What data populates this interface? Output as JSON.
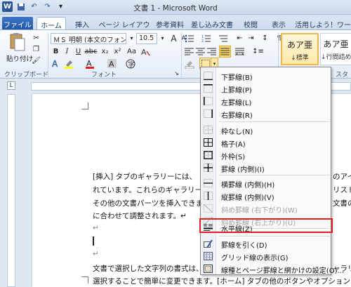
{
  "window": {
    "title": "文書 1 - Microsoft Word"
  },
  "tabs": [
    {
      "label": "ファイル"
    },
    {
      "label": "ホーム"
    },
    {
      "label": "挿入"
    },
    {
      "label": "ページ レイアウト"
    },
    {
      "label": "参考資料"
    },
    {
      "label": "差し込み文書"
    },
    {
      "label": "校閲"
    },
    {
      "label": "表示"
    },
    {
      "label": "活用しよう！ワード"
    }
  ],
  "ribbon": {
    "paste_label": "貼り付け",
    "font_name": "ＭＳ 明朝 (本文のフォン",
    "font_size": "10.5",
    "groups": {
      "clipboard": "クリップボード",
      "font": "フォント",
      "styles": "スター"
    },
    "styles": [
      {
        "sample": "あア亜",
        "name": "↓標準"
      },
      {
        "sample": "あア亜",
        "name": "↓行間詰め"
      }
    ]
  },
  "ruler": {
    "corner": "L"
  },
  "document": {
    "lines": [
      "[挿入] タブのギャラリーには、",
      "れています。これらのギャラリー",
      "その他の文書パーツを挿入できま",
      "に合わせて調整されます。↵",
      "↵",
      "",
      "↵",
      "文書で選択した文字列の書式は、",
      "選択することで簡単に変更できます。[ホーム] タブの他のボタンやオプション"
    ],
    "right_fragments": [
      "のアイ",
      "リスト",
      "文書の"
    ],
    "right_bottom": "ャラリ"
  },
  "border_menu": {
    "items": [
      {
        "label": "下罫線(B)",
        "icon": "bottom-border-icon"
      },
      {
        "label": "上罫線(P)",
        "icon": "top-border-icon"
      },
      {
        "label": "左罫線(L)",
        "icon": "left-border-icon"
      },
      {
        "label": "右罫線(R)",
        "icon": "right-border-icon"
      },
      {
        "label": "枠なし(N)",
        "icon": "no-border-icon"
      },
      {
        "label": "格子(A)",
        "icon": "all-borders-icon"
      },
      {
        "label": "外枠(S)",
        "icon": "outside-borders-icon"
      },
      {
        "label": "罫線 (内側)(I)",
        "icon": "inside-borders-icon"
      },
      {
        "label": "横罫線 (内側)(H)",
        "icon": "inside-horizontal-border-icon"
      },
      {
        "label": "縦罫線 (内側)(V)",
        "icon": "inside-vertical-border-icon"
      },
      {
        "label": "斜め罫線 (右下がり)(W)",
        "icon": "diagonal-down-border-icon",
        "disabled": true
      },
      {
        "label": "斜め罫線 (右上がり)(U)",
        "icon": "diagonal-up-border-icon",
        "disabled": true
      },
      {
        "label": "水平線(Z)",
        "icon": "horizontal-line-icon"
      },
      {
        "label": "罫線を引く(D)",
        "icon": "draw-table-icon"
      },
      {
        "label": "グリッド線の表示(G)",
        "icon": "view-gridlines-icon"
      },
      {
        "label": "線種とページ罫線と網かけの設定(O)...",
        "icon": "borders-shading-icon"
      }
    ]
  },
  "colors": {
    "accent": "#2b579a",
    "highlight": "#e02020",
    "file_tab": "#2a62b3"
  }
}
